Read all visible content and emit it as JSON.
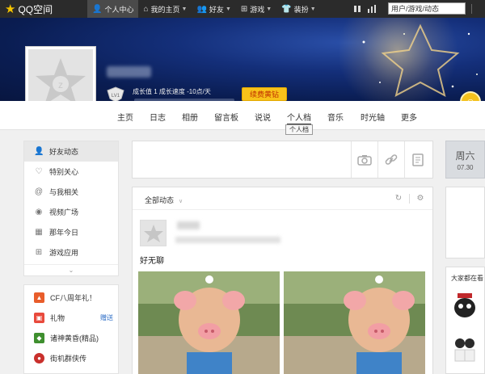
{
  "topbar": {
    "logo_text": "QQ空间",
    "nav": [
      {
        "label": "个人中心",
        "icon": "user-icon"
      },
      {
        "label": "我的主页",
        "icon": "home-icon"
      },
      {
        "label": "好友",
        "icon": "friends-icon"
      },
      {
        "label": "游戏",
        "icon": "grid-icon"
      },
      {
        "label": "装扮",
        "icon": "shirt-icon"
      }
    ],
    "search_value": "用户/游戏/动态"
  },
  "profile": {
    "level_badge": "LV1",
    "growth_text": "成长值 1   成长速度 -10点/天",
    "vip_button": "续费黄钻"
  },
  "tabs": [
    "主页",
    "日志",
    "相册",
    "留言板",
    "说说",
    "个人档",
    "音乐",
    "时光轴",
    "更多"
  ],
  "tooltip": "个人档",
  "leftnav": [
    {
      "label": "好友动态",
      "icon": "friends-feed-icon"
    },
    {
      "label": "特别关心",
      "icon": "heart-icon"
    },
    {
      "label": "与我相关",
      "icon": "at-icon"
    },
    {
      "label": "视频广场",
      "icon": "video-icon"
    },
    {
      "label": "那年今日",
      "icon": "calendar-icon"
    },
    {
      "label": "游戏应用",
      "icon": "apps-icon"
    }
  ],
  "leftapps": [
    {
      "label": "CF八周年礼！",
      "extra": ""
    },
    {
      "label": "礼物",
      "extra": "赠送"
    },
    {
      "label": "诸神黄昏(精品)",
      "extra": ""
    },
    {
      "label": "街机群侠传",
      "extra": ""
    }
  ],
  "feed": {
    "filter_label": "全部动态",
    "post_text": "好无聊"
  },
  "date": {
    "weekday": "周六",
    "date": "07.30"
  },
  "right_card_title": "大家都在看"
}
